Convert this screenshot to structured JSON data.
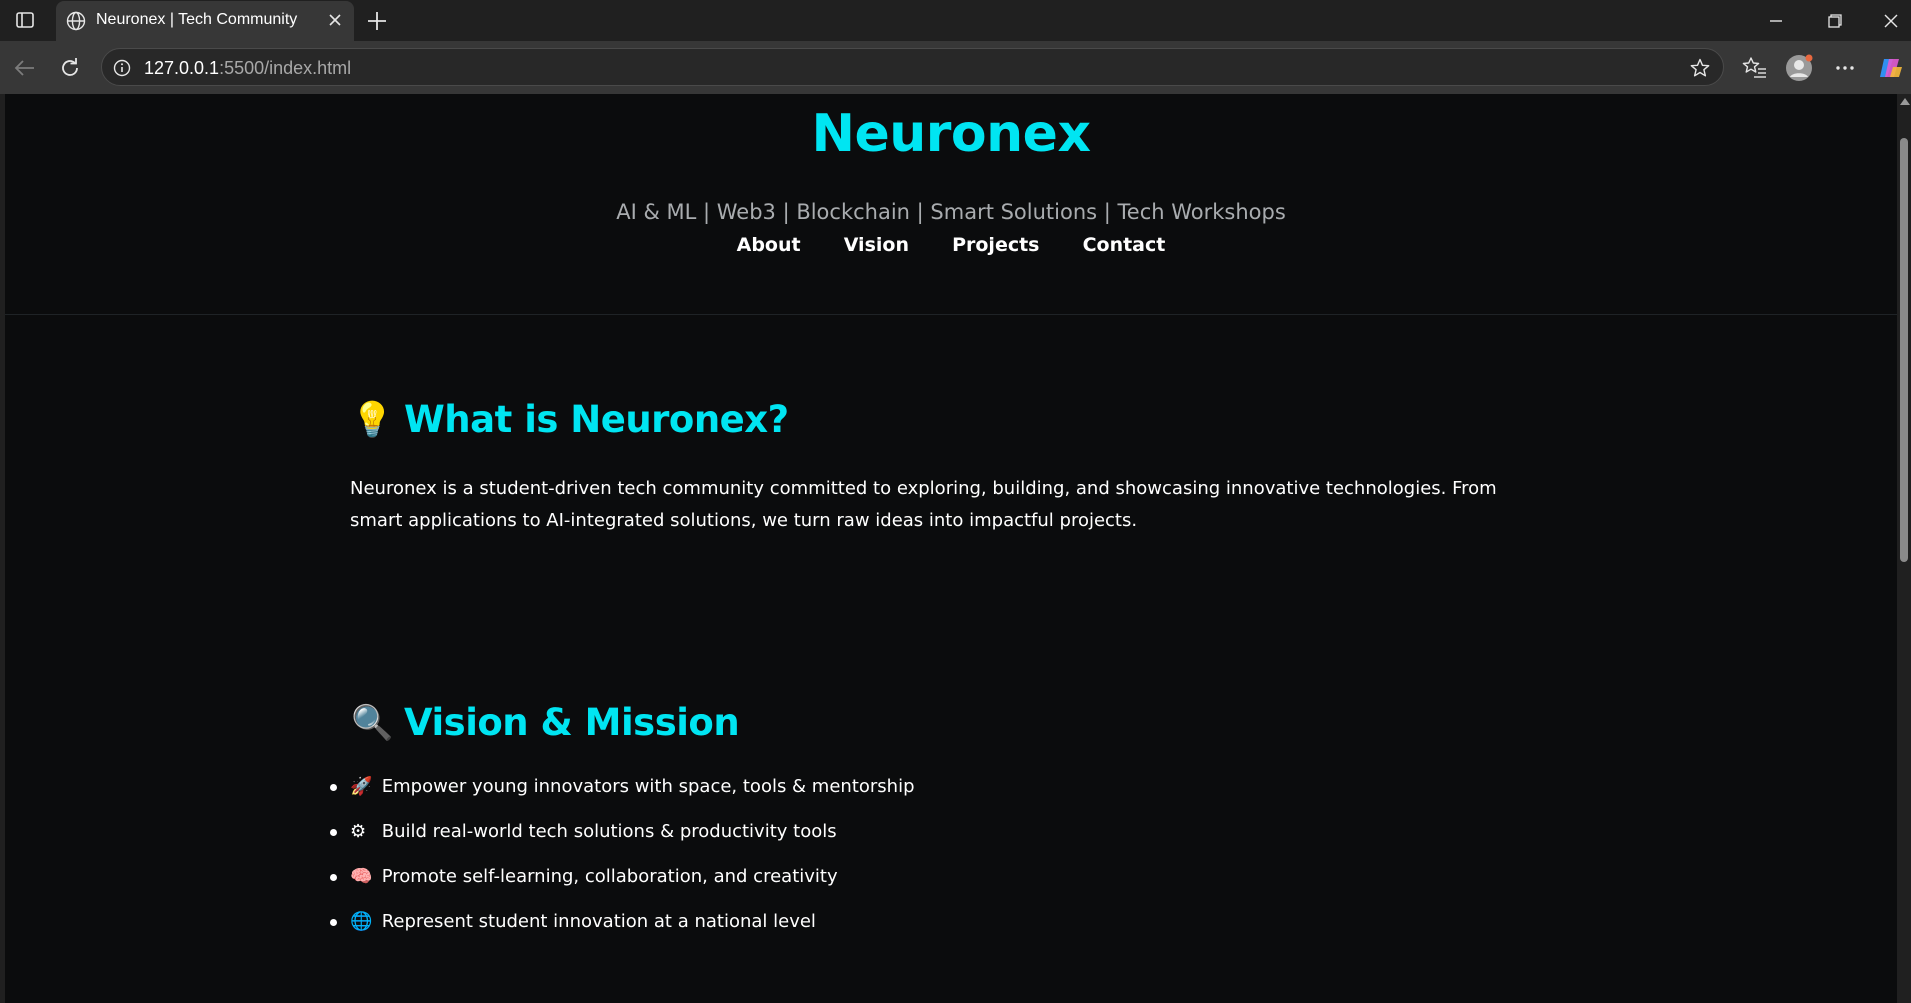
{
  "browser": {
    "tab_title": "Neuronex | Tech Community",
    "url_host": "127.0.0.1",
    "url_rest": ":5500/index.html"
  },
  "header": {
    "brand": "Neuronex",
    "tagline": "AI & ML | Web3 | Blockchain | Smart Solutions | Tech Workshops",
    "nav": [
      "About",
      "Vision",
      "Projects",
      "Contact"
    ]
  },
  "about": {
    "icon": "💡",
    "title": "What is Neuronex?",
    "text": "Neuronex is a student-driven tech community committed to exploring, building, and showcasing innovative technologies. From smart applications to AI-integrated solutions, we turn raw ideas into impactful projects."
  },
  "vision": {
    "icon": "🔍",
    "title": "Vision & Mission",
    "items": [
      {
        "icon": "🚀",
        "text": "Empower young innovators with space, tools & mentorship"
      },
      {
        "icon": "⚙",
        "text": "Build real-world tech solutions & productivity tools"
      },
      {
        "icon": "🧠",
        "text": "Promote self-learning, collaboration, and creativity"
      },
      {
        "icon": "🌐",
        "text": "Represent student innovation at a national level"
      }
    ]
  },
  "colors": {
    "accent": "#00e5f2",
    "page_bg": "#0b0c0d",
    "muted_text": "#a9acaf"
  }
}
